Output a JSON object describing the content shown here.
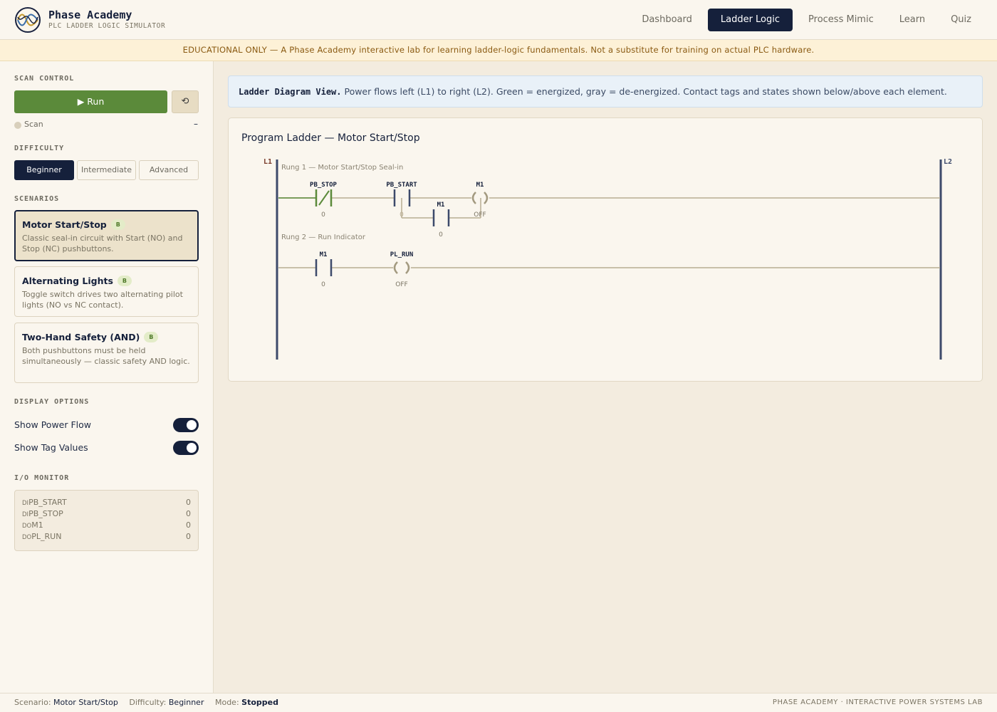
{
  "brand": {
    "name": "Phase Academy",
    "subtitle": "PLC LADDER LOGIC SIMULATOR"
  },
  "nav": [
    {
      "label": "Dashboard",
      "active": false
    },
    {
      "label": "Ladder Logic",
      "active": true
    },
    {
      "label": "Process Mimic",
      "active": false
    },
    {
      "label": "Learn",
      "active": false
    },
    {
      "label": "Quiz",
      "active": false
    }
  ],
  "banner": "EDUCATIONAL ONLY — A Phase Academy interactive lab for learning ladder-logic fundamentals. Not a substitute for training on actual PLC hardware.",
  "sidebar": {
    "scan_control": {
      "title": "SCAN CONTROL",
      "run_label": "▶ Run",
      "reset_label": "⟲",
      "scan_label": "Scan",
      "scan_value": "–"
    },
    "difficulty": {
      "title": "DIFFICULTY",
      "options": [
        "Beginner",
        "Intermediate",
        "Advanced"
      ],
      "selected": "Beginner"
    },
    "scenarios": {
      "title": "SCENARIOS",
      "items": [
        {
          "title": "Motor Start/Stop",
          "badge": "B",
          "desc": "Classic seal-in circuit with Start (NO) and Stop (NC) pushbuttons.",
          "active": true
        },
        {
          "title": "Alternating Lights",
          "badge": "B",
          "desc": "Toggle switch drives two alternating pilot lights (NO vs NC contact).",
          "active": false
        },
        {
          "title": "Two-Hand Safety (AND)",
          "badge": "B",
          "desc": "Both pushbuttons must be held simultaneously — classic safety AND logic.",
          "active": false
        }
      ]
    },
    "display_options": {
      "title": "DISPLAY OPTIONS",
      "power_flow_label": "Show Power Flow",
      "power_flow_on": true,
      "tag_values_label": "Show Tag Values",
      "tag_values_on": true
    },
    "io_monitor": {
      "title": "I/O MONITOR",
      "rows": [
        {
          "type": "DI",
          "tag": "PB_START",
          "value": "0"
        },
        {
          "type": "DI",
          "tag": "PB_STOP",
          "value": "0"
        },
        {
          "type": "DO",
          "tag": "M1",
          "value": "0"
        },
        {
          "type": "DO",
          "tag": "PL_RUN",
          "value": "0"
        }
      ]
    }
  },
  "main": {
    "info_bold": "Ladder Diagram View.",
    "info_text": " Power flows left (L1) to right (L2). Green = energized, gray = de-energized. Contact tags and states shown below/above each element.",
    "ladder": {
      "title": "Program Ladder — Motor Start/Stop",
      "rail_left": "L1",
      "rail_right": "L2",
      "rung1_label": "Rung 1 — Motor Start/Stop Seal-in",
      "rung2_label": "Rung 2 — Run Indicator",
      "elements": {
        "pb_stop": {
          "tag": "PB_STOP",
          "state": "0"
        },
        "pb_start": {
          "tag": "PB_START",
          "state": "0"
        },
        "m1_coil": {
          "tag": "M1",
          "state": "OFF"
        },
        "m1_seal": {
          "tag": "M1",
          "state": "0"
        },
        "m1_contact": {
          "tag": "M1",
          "state": "0"
        },
        "pl_run": {
          "tag": "PL_RUN",
          "state": "OFF"
        }
      }
    }
  },
  "status": {
    "scenario_label": "Scenario:",
    "scenario_value": "Motor Start/Stop",
    "difficulty_label": "Difficulty:",
    "difficulty_value": "Beginner",
    "mode_label": "Mode:",
    "mode_value": "Stopped",
    "right_text": "PHASE ACADEMY · INTERACTIVE POWER SYSTEMS LAB"
  },
  "colors": {
    "navy": "#15203b",
    "energized": "#5b8a3a",
    "deenergized": "#b8ad92",
    "rail": "#3d4a6b"
  }
}
